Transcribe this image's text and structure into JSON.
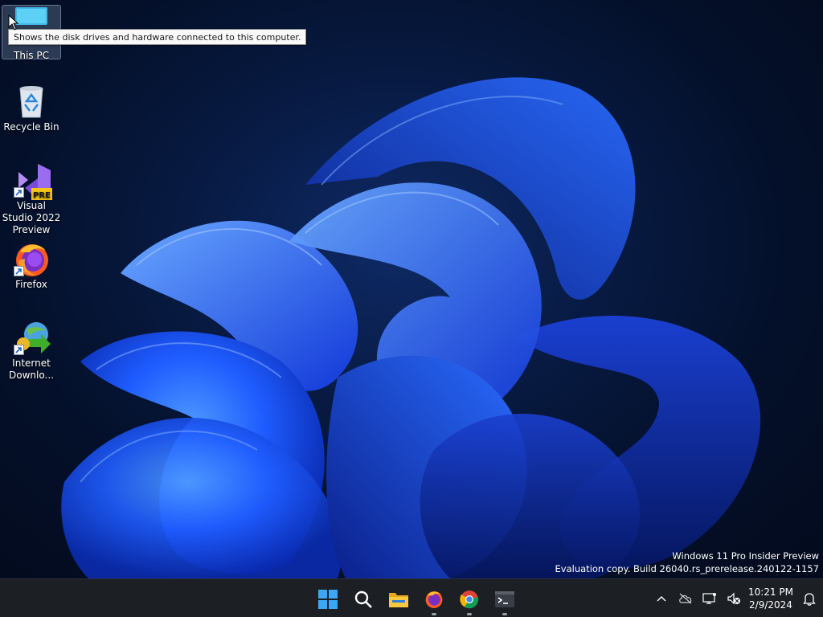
{
  "desktop": {
    "icons": [
      {
        "label": "This PC",
        "icon": "this-pc-icon",
        "selected": true
      },
      {
        "label": "Recycle Bin",
        "icon": "recycle-bin-icon"
      },
      {
        "label": "Visual Studio 2022 Preview",
        "icon": "visual-studio-icon",
        "badge": "PRE"
      },
      {
        "label": "Firefox",
        "icon": "firefox-icon"
      },
      {
        "label": "Internet Downlo...",
        "icon": "internet-download-manager-icon"
      }
    ],
    "tooltip": "Shows the disk drives and hardware connected to this computer."
  },
  "watermark": {
    "line1": "Windows 11 Pro Insider Preview",
    "line2": "Evaluation copy. Build 26040.rs_prerelease.240122-1157"
  },
  "taskbar": {
    "apps": [
      {
        "name": "Start",
        "icon": "windows-start-icon"
      },
      {
        "name": "Search",
        "icon": "search-icon"
      },
      {
        "name": "File Explorer",
        "icon": "folder-icon"
      },
      {
        "name": "Firefox",
        "icon": "firefox-icon",
        "running": true
      },
      {
        "name": "Google Chrome",
        "icon": "chrome-icon",
        "running": true
      },
      {
        "name": "Terminal",
        "icon": "terminal-icon",
        "running": true
      }
    ],
    "tray": {
      "icons": [
        "chevron-up-icon",
        "cloud-offline-icon",
        "network-icon",
        "volume-muted-icon"
      ],
      "time": "10:21 PM",
      "date": "2/9/2024",
      "notifications_icon": "bell-icon"
    }
  },
  "colors": {
    "taskbar_bg": "#1c1f24",
    "accent": "#1f6fff",
    "wallpaper_dark": "#04102a"
  }
}
